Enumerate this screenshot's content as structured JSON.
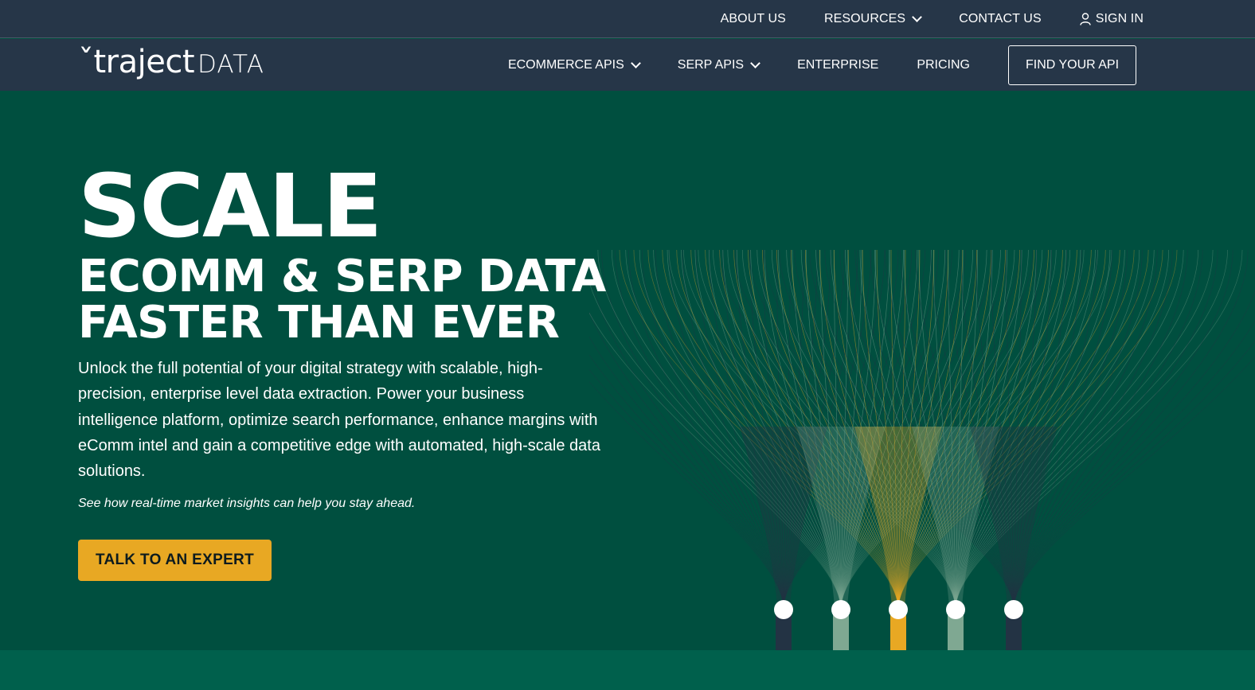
{
  "topbar": {
    "about": "ABOUT US",
    "resources": "RESOURCES",
    "contact": "CONTACT US",
    "signin": "SIGN IN"
  },
  "mainbar": {
    "logo_brand": "ˇtraject",
    "logo_data": "DATA",
    "ecommerce": "ECOMMERCE APIS",
    "serp": "SERP APIS",
    "enterprise": "ENTERPRISE",
    "pricing": "PRICING",
    "find_api": "FIND YOUR API"
  },
  "hero": {
    "headline_big": "SCALE",
    "headline_line1": "ECOMM & SERP DATA",
    "headline_line2": "FASTER THAN EVER",
    "description": "Unlock the full potential of your digital strategy with scalable, high-precision, enterprise level data extraction. Power your business intelligence platform, optimize search performance, enhance margins with eComm intel and gain a competitive edge with automated, high-scale data solutions.",
    "tagline": "See how real-time market insights can help you stay ahead.",
    "cta": "TALK TO AN EXPERT"
  },
  "colors": {
    "nav_bg": "#263648",
    "hero_bg": "#004f3f",
    "accent_yellow": "#e8a823",
    "accent_sage": "#7fa892",
    "accent_navy": "#233344",
    "band_bg": "#00604c"
  },
  "icons": {
    "resources_chevron": "chevron-down-icon",
    "signin_user": "user-icon"
  }
}
